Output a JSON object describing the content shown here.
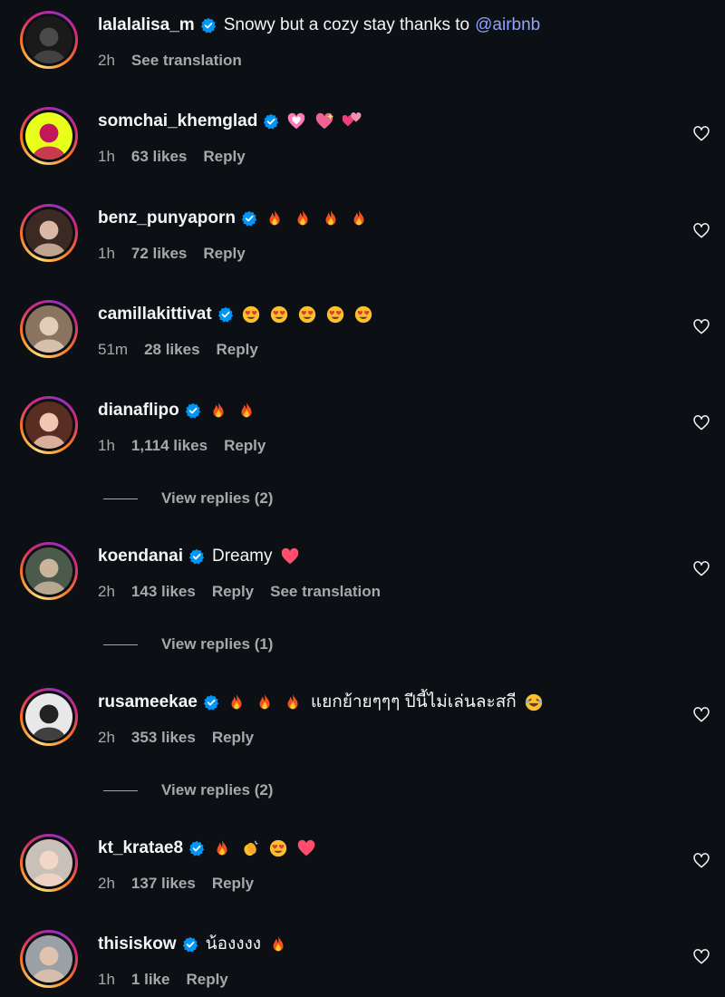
{
  "comments": [
    {
      "username": "lalalalisa_m",
      "text": "Snowy but a cozy stay thanks to",
      "mention": "@airbnb",
      "time": "2h",
      "likes": "",
      "reply": "",
      "translation": "See translation",
      "emojis": [],
      "avatar_colors": [
        "#1a1a1a",
        "#4a4a4a"
      ]
    },
    {
      "username": "somchai_khemglad",
      "text": "",
      "time": "1h",
      "likes": "63 likes",
      "reply": "Reply",
      "translation": "",
      "emojis": [
        "pink-heart",
        "sparkling-heart",
        "two-hearts"
      ],
      "avatar_colors": [
        "#e8ff1a",
        "#c2185b"
      ]
    },
    {
      "username": "benz_punyaporn",
      "text": "",
      "time": "1h",
      "likes": "72 likes",
      "reply": "Reply",
      "translation": "",
      "emojis": [
        "fire",
        "fire",
        "fire",
        "fire"
      ],
      "avatar_colors": [
        "#3b2a24",
        "#d9b8a6"
      ]
    },
    {
      "username": "camillakittivat",
      "text": "",
      "time": "51m",
      "likes": "28 likes",
      "reply": "Reply",
      "translation": "",
      "emojis": [
        "heart-eyes",
        "heart-eyes",
        "heart-eyes",
        "heart-eyes",
        "heart-eyes"
      ],
      "avatar_colors": [
        "#8a7460",
        "#e3cdb8"
      ]
    },
    {
      "username": "dianaflipo",
      "text": "",
      "time": "1h",
      "likes": "1,114 likes",
      "reply": "Reply",
      "translation": "",
      "emojis": [
        "fire",
        "fire"
      ],
      "avatar_colors": [
        "#5a2d22",
        "#f0c7b0"
      ]
    },
    {
      "username": "koendanai",
      "text": "Dreamy",
      "time": "2h",
      "likes": "143 likes",
      "reply": "Reply",
      "translation": "See translation",
      "emojis": [
        "red-heart"
      ],
      "avatar_colors": [
        "#4b5a4a",
        "#c9b59c"
      ]
    },
    {
      "username": "rusameekae",
      "text": "แยกย้ายๆๆๆ ปีนี้ไม่เล่นละสกี",
      "time": "2h",
      "likes": "353 likes",
      "reply": "Reply",
      "translation": "",
      "emojis_before": [
        "fire",
        "fire",
        "fire"
      ],
      "emojis": [
        "laughing"
      ],
      "avatar_colors": [
        "#e8e8e8",
        "#222222"
      ]
    },
    {
      "username": "kt_kratae8",
      "text": "",
      "time": "2h",
      "likes": "137 likes",
      "reply": "Reply",
      "translation": "",
      "emojis": [
        "fire",
        "clap",
        "heart-eyes",
        "red-heart"
      ],
      "avatar_colors": [
        "#c9c1b8",
        "#f2d6c6"
      ]
    },
    {
      "username": "thisiskow",
      "text": "น้องงงง",
      "time": "1h",
      "likes": "1 like",
      "reply": "Reply",
      "translation": "",
      "emojis": [
        "fire"
      ],
      "avatar_colors": [
        "#9aa0a6",
        "#e0c3ae"
      ]
    }
  ],
  "view_replies": [
    "View replies (2)",
    "View replies (1)",
    "View replies (2)"
  ],
  "colors": {
    "background": "#0c1014",
    "text": "#f5f5f5",
    "muted": "#a8a8a8",
    "mention": "#8fa3ff",
    "verified": "#0095f6"
  },
  "icons": {
    "verified": "verified-badge-icon",
    "like": "heart-outline-icon"
  }
}
